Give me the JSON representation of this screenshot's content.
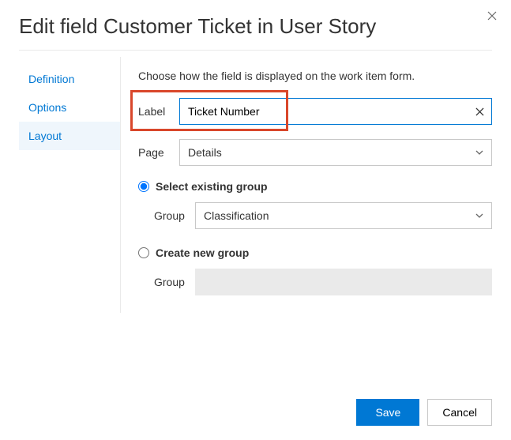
{
  "dialog": {
    "title": "Edit field Customer Ticket in User Story"
  },
  "sidebar": {
    "items": [
      {
        "label": "Definition",
        "selected": false
      },
      {
        "label": "Options",
        "selected": false
      },
      {
        "label": "Layout",
        "selected": true
      }
    ]
  },
  "content": {
    "intro": "Choose how the field is displayed on the work item form.",
    "label_field": {
      "label": "Label",
      "value": "Ticket Number"
    },
    "page_field": {
      "label": "Page",
      "value": "Details"
    },
    "group_option_existing": {
      "label": "Select existing group",
      "checked": true,
      "group_label": "Group",
      "group_value": "Classification"
    },
    "group_option_new": {
      "label": "Create new group",
      "checked": false,
      "group_label": "Group",
      "group_value": ""
    }
  },
  "footer": {
    "save": "Save",
    "cancel": "Cancel"
  }
}
